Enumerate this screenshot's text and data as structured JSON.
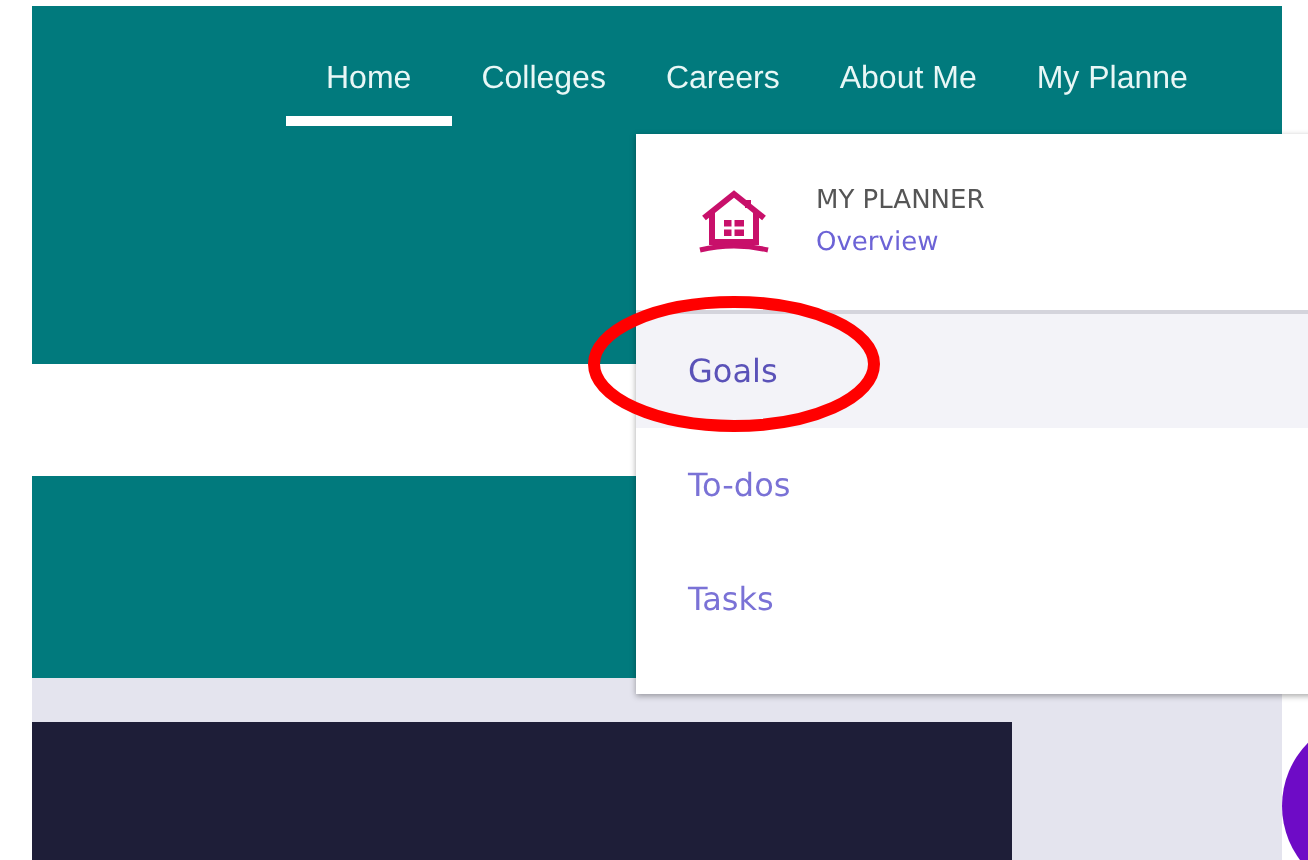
{
  "nav": [
    {
      "label": "Home",
      "selected": true
    },
    {
      "label": "Colleges",
      "selected": false
    },
    {
      "label": "Careers",
      "selected": false
    },
    {
      "label": "About Me",
      "selected": false
    },
    {
      "label": "My Planne",
      "selected": false
    }
  ],
  "planner_menu": {
    "heading": "MY PLANNER",
    "link": "Overview",
    "items": [
      {
        "label": "Goals",
        "selected": true
      },
      {
        "label": "To-dos",
        "selected": false
      },
      {
        "label": "Tasks",
        "selected": false
      }
    ]
  }
}
